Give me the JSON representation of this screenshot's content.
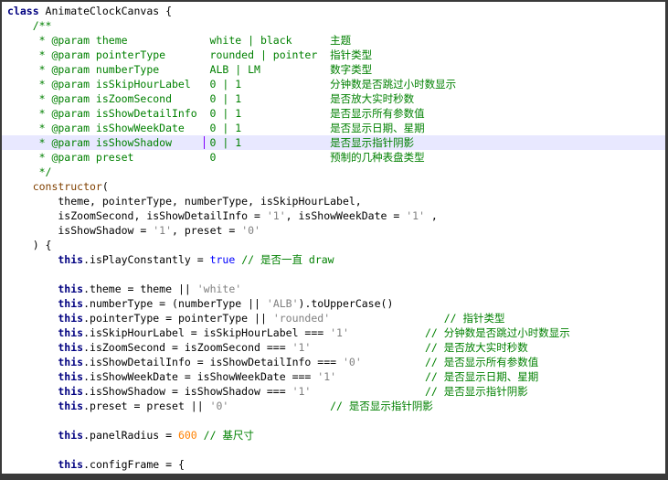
{
  "colors": {
    "comment": "#008000",
    "keyword": "#000080",
    "keyword_alt": "#0000ff",
    "string": "#808080",
    "number": "#ff8000",
    "highlight_line": "#e8e8ff",
    "background": "#ffffff"
  },
  "editor": {
    "current_line": 9,
    "lines": [
      [
        [
          "kw",
          "class"
        ],
        [
          "plain",
          " AnimateClockCanvas {"
        ]
      ],
      [
        [
          "comment",
          "    /**"
        ]
      ],
      [
        [
          "comment",
          "     * @param theme             white | black      主题"
        ]
      ],
      [
        [
          "comment",
          "     * @param pointerType       rounded | pointer  指针类型"
        ]
      ],
      [
        [
          "comment",
          "     * @param numberType        ALB | LM           数字类型"
        ]
      ],
      [
        [
          "comment",
          "     * @param isSkipHourLabel   0 | 1              分钟数是否跳过小时数显示"
        ]
      ],
      [
        [
          "comment",
          "     * @param isZoomSecond      0 | 1              是否放大实时秒数"
        ]
      ],
      [
        [
          "comment",
          "     * @param isShowDetailInfo  0 | 1              是否显示所有参数值"
        ]
      ],
      [
        [
          "comment",
          "     * @param isShowWeekDate    0 | 1              是否显示日期、星期"
        ]
      ],
      [
        [
          "comment",
          "     * @param isShowShadow      0 | 1              是否显示指针阴影"
        ]
      ],
      [
        [
          "comment",
          "     * @param preset            0                  预制的几种表盘类型"
        ]
      ],
      [
        [
          "comment",
          "     */"
        ]
      ],
      [
        [
          "fn",
          "    constructor"
        ],
        [
          "plain",
          "("
        ]
      ],
      [
        [
          "plain",
          "        theme, pointerType, numberType, isSkipHourLabel,"
        ]
      ],
      [
        [
          "plain",
          "        isZoomSecond, isShowDetailInfo = "
        ],
        [
          "str",
          "'1'"
        ],
        [
          "plain",
          ", isShowWeekDate = "
        ],
        [
          "str",
          "'1'"
        ],
        [
          "plain",
          " ,"
        ]
      ],
      [
        [
          "plain",
          "        isShowShadow = "
        ],
        [
          "str",
          "'1'"
        ],
        [
          "plain",
          ", preset = "
        ],
        [
          "str",
          "'0'"
        ]
      ],
      [
        [
          "plain",
          "    ) {"
        ]
      ],
      [
        [
          "kw",
          "        this"
        ],
        [
          "plain",
          ".isPlayConstantly = "
        ],
        [
          "kw2",
          "true"
        ],
        [
          "comment",
          " // 是否一直 draw"
        ]
      ],
      [
        [
          "plain",
          ""
        ]
      ],
      [
        [
          "kw",
          "        this"
        ],
        [
          "plain",
          ".theme = theme || "
        ],
        [
          "str",
          "'white'"
        ]
      ],
      [
        [
          "kw",
          "        this"
        ],
        [
          "plain",
          ".numberType = (numberType || "
        ],
        [
          "str",
          "'ALB'"
        ],
        [
          "plain",
          ").toUpperCase()"
        ]
      ],
      [
        [
          "kw",
          "        this"
        ],
        [
          "plain",
          ".pointerType = pointerType || "
        ],
        [
          "str",
          "'rounded'"
        ],
        [
          "comment",
          "                  // 指针类型"
        ]
      ],
      [
        [
          "kw",
          "        this"
        ],
        [
          "plain",
          ".isSkipHourLabel = isSkipHourLabel === "
        ],
        [
          "str",
          "'1'"
        ],
        [
          "comment",
          "            // 分钟数是否跳过小时数显示"
        ]
      ],
      [
        [
          "kw",
          "        this"
        ],
        [
          "plain",
          ".isZoomSecond = isZoomSecond === "
        ],
        [
          "str",
          "'1'"
        ],
        [
          "comment",
          "                  // 是否放大实时秒数"
        ]
      ],
      [
        [
          "kw",
          "        this"
        ],
        [
          "plain",
          ".isShowDetailInfo = isShowDetailInfo === "
        ],
        [
          "str",
          "'0'"
        ],
        [
          "comment",
          "          // 是否显示所有参数值"
        ]
      ],
      [
        [
          "kw",
          "        this"
        ],
        [
          "plain",
          ".isShowWeekDate = isShowWeekDate === "
        ],
        [
          "str",
          "'1'"
        ],
        [
          "comment",
          "              // 是否显示日期、星期"
        ]
      ],
      [
        [
          "kw",
          "        this"
        ],
        [
          "plain",
          ".isShowShadow = isShowShadow === "
        ],
        [
          "str",
          "'1'"
        ],
        [
          "comment",
          "                  // 是否显示指针阴影"
        ]
      ],
      [
        [
          "kw",
          "        this"
        ],
        [
          "plain",
          ".preset = preset || "
        ],
        [
          "str",
          "'0'"
        ],
        [
          "comment",
          "                // 是否显示指针阴影"
        ]
      ],
      [
        [
          "plain",
          ""
        ]
      ],
      [
        [
          "kw",
          "        this"
        ],
        [
          "plain",
          ".panelRadius = "
        ],
        [
          "num",
          "600"
        ],
        [
          "comment",
          " // 基尺寸"
        ]
      ],
      [
        [
          "plain",
          ""
        ]
      ],
      [
        [
          "kw",
          "        this"
        ],
        [
          "plain",
          ".configFrame = {"
        ]
      ]
    ]
  }
}
